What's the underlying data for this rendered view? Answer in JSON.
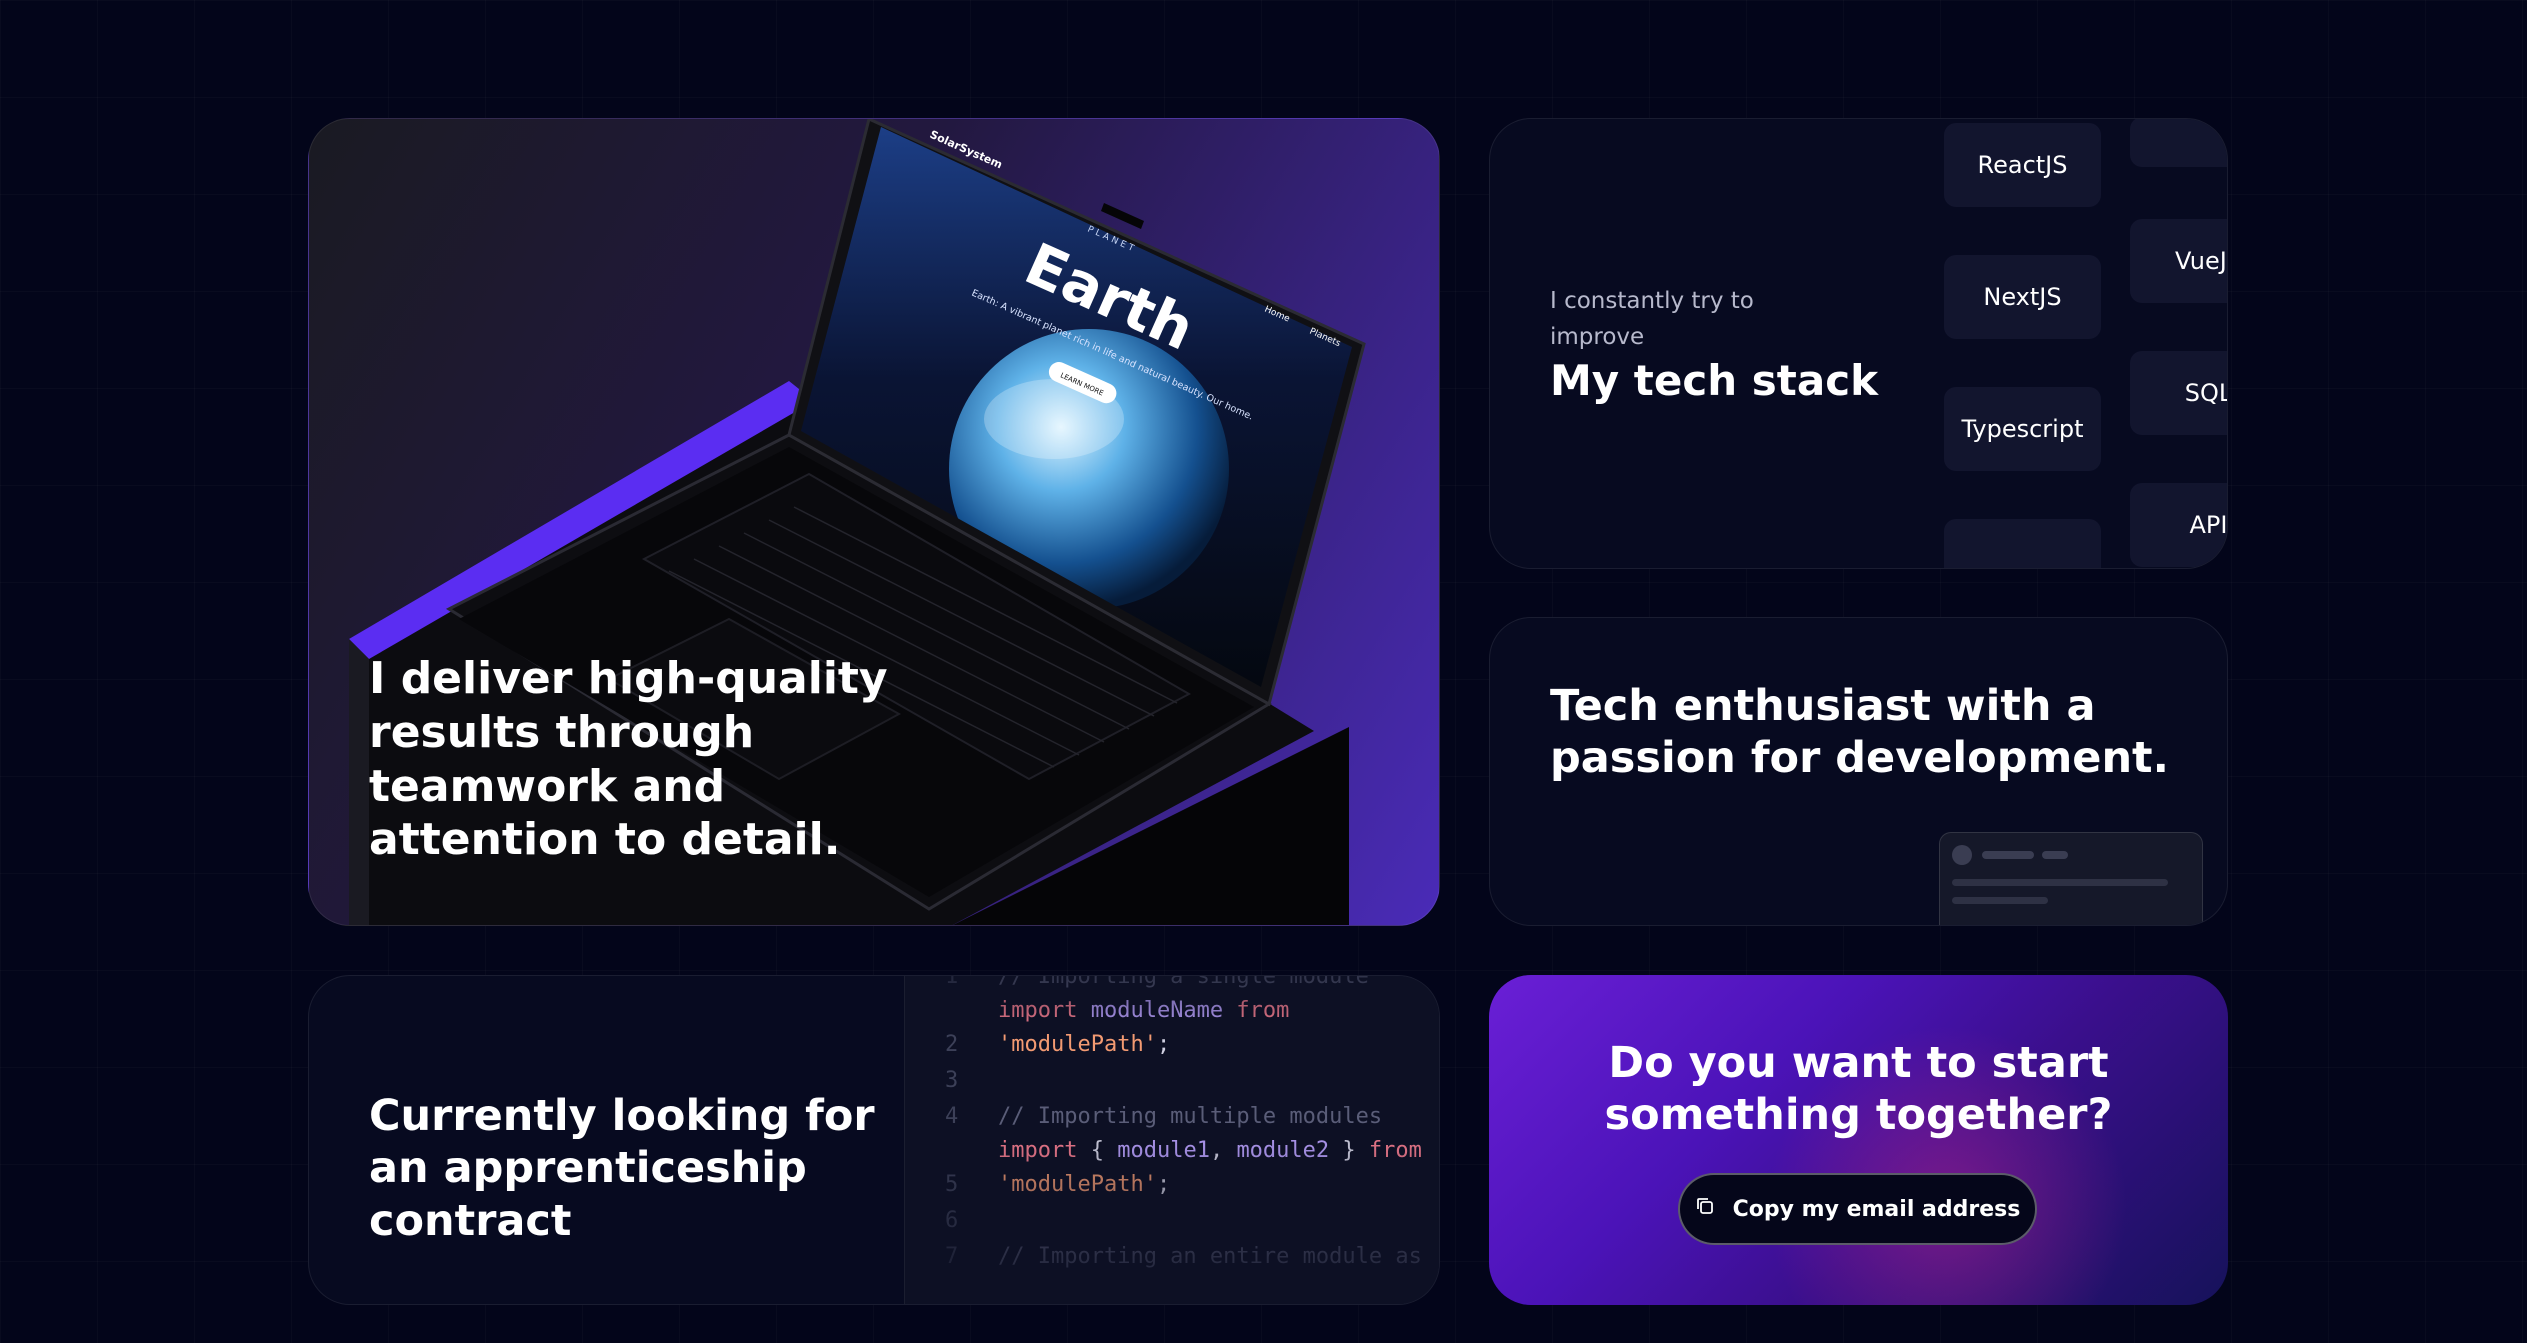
{
  "hero": {
    "headline": "I deliver high-quality results through teamwork and attention to detail.",
    "screen": {
      "brand": "SolarSystem",
      "kicker": "PLANET",
      "title": "Earth",
      "subtitle": "Earth: A vibrant planet rich in life and natural beauty. Our home.",
      "cta": "LEARN MORE",
      "nav": [
        "Home",
        "Planets"
      ]
    }
  },
  "stack": {
    "eyebrow": "I constantly try to improve",
    "title": "My tech stack",
    "left_column": [
      "ReactJS",
      "NextJS",
      "Typescript",
      ""
    ],
    "right_column": [
      "",
      "VueJS",
      "SQL",
      "API"
    ]
  },
  "enthusiast": {
    "headline": "Tech enthusiast with a passion for development."
  },
  "apprentice": {
    "headline": "Currently looking for an apprenticeship contract",
    "code": [
      {
        "ln": "1",
        "parts": [
          {
            "t": "// Importing a single module",
            "c": "c-comment"
          }
        ]
      },
      {
        "ln": "",
        "parts": [
          {
            "t": "import ",
            "c": "c-kw"
          },
          {
            "t": "moduleName ",
            "c": "c-id"
          },
          {
            "t": "from",
            "c": "c-kw"
          }
        ]
      },
      {
        "ln": "2",
        "parts": [
          {
            "t": "'modulePath'",
            "c": "c-str"
          },
          {
            "t": ";",
            "c": "c-punc"
          }
        ]
      },
      {
        "ln": "3",
        "parts": []
      },
      {
        "ln": "4",
        "parts": [
          {
            "t": "// Importing multiple modules",
            "c": "c-comment"
          }
        ]
      },
      {
        "ln": "",
        "parts": [
          {
            "t": "import ",
            "c": "c-kw"
          },
          {
            "t": "{ ",
            "c": "c-punc"
          },
          {
            "t": "module1",
            "c": "c-id"
          },
          {
            "t": ", ",
            "c": "c-punc"
          },
          {
            "t": "module2",
            "c": "c-id"
          },
          {
            "t": " } ",
            "c": "c-punc"
          },
          {
            "t": "from",
            "c": "c-kw"
          }
        ]
      },
      {
        "ln": "5",
        "parts": [
          {
            "t": "'modulePath'",
            "c": "c-str"
          },
          {
            "t": ";",
            "c": "c-punc"
          }
        ]
      },
      {
        "ln": "6",
        "parts": []
      },
      {
        "ln": "7",
        "parts": [
          {
            "t": "// Importing an entire module as",
            "c": "c-comment"
          }
        ]
      }
    ]
  },
  "cta": {
    "headline": "Do you want to start something together?",
    "button_label": "Copy my email address",
    "button_icon": "copy-icon"
  },
  "colors": {
    "background": "#03051a",
    "card": "#070a20",
    "accent_purple": "#6a1fd6",
    "pill": "#12152e"
  }
}
